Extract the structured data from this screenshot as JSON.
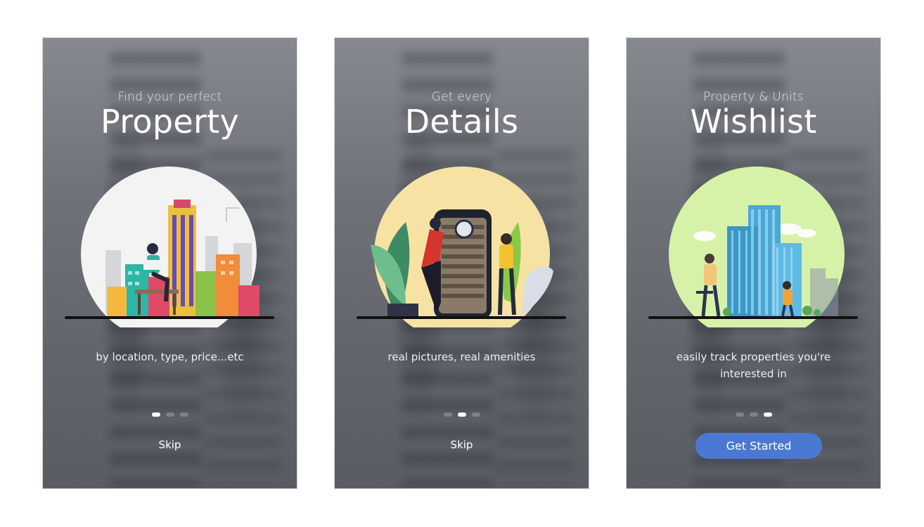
{
  "screens": [
    {
      "subtitle": "Find your perfect",
      "title": "Property",
      "description": "by location, type, price...etc",
      "pagination": [
        "inactive",
        "inactive",
        "inactive"
      ],
      "skip_label": "Skip",
      "illustration": "city-buildings-woman-reading-illustration",
      "accent_color": "#f3f3f3"
    },
    {
      "subtitle": "Get every",
      "title": "Details",
      "description": "real pictures, real amenities",
      "skip_label": "Skip",
      "illustration": "phone-building-magnifier-illustration",
      "accent_color": "#f6e3a4"
    },
    {
      "subtitle": "Property & Units",
      "title": "Wishlist",
      "description": "easily track properties you're interested in",
      "cta_label": "Get Started",
      "illustration": "glass-towers-people-illustration",
      "accent_color": "#d6f2a9",
      "button_color": "#4b78d3"
    }
  ]
}
